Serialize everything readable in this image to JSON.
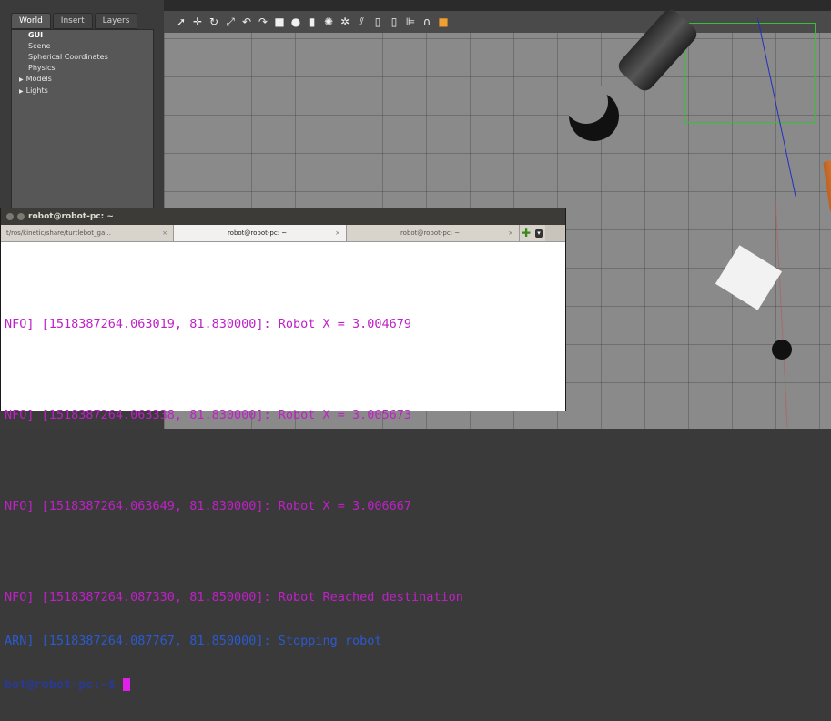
{
  "gazebo": {
    "tabs": [
      "World",
      "Insert",
      "Layers"
    ],
    "tree": [
      {
        "label": "GUI",
        "bold": true
      },
      {
        "label": "Scene",
        "bold": false
      },
      {
        "label": "Spherical Coordinates",
        "bold": false
      },
      {
        "label": "Physics",
        "bold": false
      },
      {
        "label": "Models",
        "bold": false,
        "arrow": true
      },
      {
        "label": "Lights",
        "bold": false,
        "arrow": true
      }
    ],
    "toolbar_icons": [
      "select-arrow-icon",
      "translate-icon",
      "rotate-icon",
      "scale-icon",
      "undo-icon",
      "redo-icon",
      "box-icon",
      "sphere-icon",
      "cylinder-icon",
      "point-light-icon",
      "spot-light-icon",
      "directional-light-icon",
      "copy-icon",
      "paste-icon",
      "align-icon",
      "snap-icon",
      "change-view-icon"
    ]
  },
  "terminal": {
    "title": "robot@robot-pc: ~",
    "tabs": [
      {
        "label": "t/ros/kinetic/share/turtlebot_ga...",
        "close": "×"
      },
      {
        "label": "robot@robot-pc: ~",
        "close": "×"
      },
      {
        "label": "robot@robot-pc: ~",
        "close": "×"
      }
    ],
    "lines": [
      {
        "text": "NFO] [1518387264.063019, 81.830000]: Robot X = 3.004679",
        "color": "magenta"
      },
      {
        "text": "NFO] [1518387264.063338, 81.830000]: Robot X = 3.005673",
        "color": "magenta"
      },
      {
        "text": "NFO] [1518387264.063649, 81.830000]: Robot X = 3.006667",
        "color": "magenta"
      },
      {
        "text": "NFO] [1518387264.087330, 81.850000]: Robot Reached destination",
        "color": "magenta"
      },
      {
        "text": "ARN] [1518387264.087767, 81.850000]: Stopping robot",
        "color": "blue"
      }
    ],
    "prompt": "bot@robot-pc:~$ "
  },
  "colors": {
    "info": "#c020c8",
    "warn": "#2a5ad0",
    "prompt": "#2a3a90",
    "cursor": "#e020e8"
  }
}
